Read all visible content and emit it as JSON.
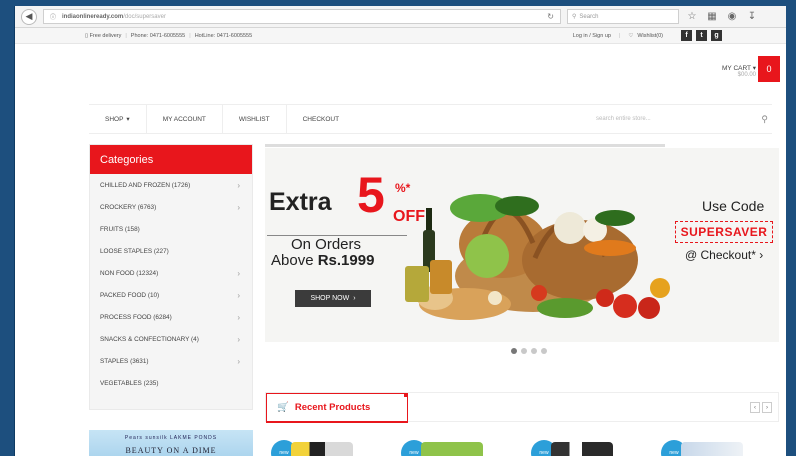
{
  "browser": {
    "url_domain": "indiaonlineready.com",
    "url_path": "/doc/supersaver",
    "search_placeholder": "Search"
  },
  "topbar": {
    "delivery": "Free delivery",
    "phone": "Phone: 0471-6005555",
    "hotline": "HotLine: 0471-6005555",
    "login": "Log in / Sign up",
    "wishlist": "Wishlist(0)"
  },
  "header": {
    "cart_label": "MY CART",
    "cart_price": "$00.00",
    "cart_count": "0"
  },
  "nav": {
    "items": [
      "SHOP",
      "MY ACCOUNT",
      "WISHLIST",
      "CHECKOUT"
    ],
    "search_placeholder": "search entire store..."
  },
  "categories": {
    "title": "Categories",
    "items": [
      {
        "label": "CHILLED AND FROZEN (1726)",
        "arrow": true
      },
      {
        "label": "CROCKERY (6763)",
        "arrow": true
      },
      {
        "label": "FRUITS (158)",
        "arrow": false
      },
      {
        "label": "LOOSE STAPLES (227)",
        "arrow": false
      },
      {
        "label": "NON FOOD (12324)",
        "arrow": true
      },
      {
        "label": "PACKED FOOD (10)",
        "arrow": true
      },
      {
        "label": "PROCESS FOOD (6284)",
        "arrow": true
      },
      {
        "label": "SNACKS & CONFECTIONARY (4)",
        "arrow": true
      },
      {
        "label": "STAPLES (3631)",
        "arrow": true
      },
      {
        "label": "VEGETABLES (235)",
        "arrow": false
      }
    ]
  },
  "ad": {
    "brands": "Pears  sunsilk  LAKME  PONDS",
    "title": "BEAUTY ON A DIME"
  },
  "banner": {
    "extra": "Extra",
    "five": "5",
    "pct": "%*",
    "off": "OFF",
    "on_orders": "On Orders",
    "above_prefix": "Above",
    "above_amount": "Rs.1999",
    "shop_now": "SHOP NOW",
    "use_code": "Use Code",
    "code": "SUPERSAVER",
    "checkout": "@ Checkout*"
  },
  "recent": {
    "title": "Recent Products",
    "badge": "new"
  }
}
